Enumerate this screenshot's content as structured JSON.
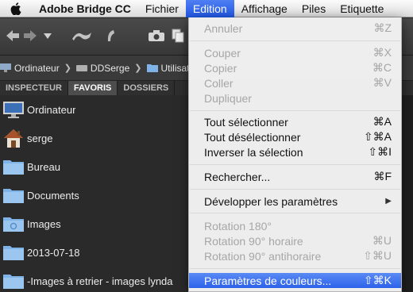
{
  "menubar": {
    "apple_icon": "apple-logo",
    "app_name": "Adobe Bridge CC",
    "items": [
      "Fichier",
      "Edition",
      "Affichage",
      "Piles",
      "Etiquette"
    ],
    "active_index": 1
  },
  "toolbar": {
    "icons": [
      "back-arrow",
      "forward-arrow",
      "dropdown-arrow",
      "boomerang",
      "rotate",
      "camera",
      "copy"
    ]
  },
  "path": {
    "crumbs": [
      "Ordinateur",
      "DDSerge",
      "Utilisat"
    ]
  },
  "tabs": [
    "INSPECTEUR",
    "FAVORIS",
    "DOSSIERS"
  ],
  "tabs_active": 1,
  "favorites": [
    {
      "label": "Ordinateur",
      "icon": "computer-icon"
    },
    {
      "label": "serge",
      "icon": "home-icon"
    },
    {
      "label": "Bureau",
      "icon": "folder-icon"
    },
    {
      "label": "Documents",
      "icon": "folder-icon"
    },
    {
      "label": "Images",
      "icon": "folder-icon"
    },
    {
      "label": "2013-07-18",
      "icon": "folder-icon"
    },
    {
      "label": "-Images à retrier - images lynda",
      "icon": "folder-icon"
    }
  ],
  "edition_menu": {
    "items": [
      {
        "label": "Annuler",
        "shortcut": "⌘Z",
        "enabled": false
      },
      {
        "label": "Couper",
        "shortcut": "⌘X",
        "enabled": false
      },
      {
        "label": "Copier",
        "shortcut": "⌘C",
        "enabled": false
      },
      {
        "label": "Coller",
        "shortcut": "⌘V",
        "enabled": false
      },
      {
        "label": "Dupliquer",
        "shortcut": "",
        "enabled": false
      },
      {
        "label": "Tout sélectionner",
        "shortcut": "⌘A",
        "enabled": true
      },
      {
        "label": "Tout désélectionner",
        "shortcut": "⇧⌘A",
        "enabled": true
      },
      {
        "label": "Inverser la sélection",
        "shortcut": "⇧⌘I",
        "enabled": true
      },
      {
        "label": "Rechercher...",
        "shortcut": "⌘F",
        "enabled": true
      },
      {
        "label": "Développer les paramètres",
        "shortcut": "▶",
        "enabled": true
      },
      {
        "label": "Rotation 180°",
        "shortcut": "",
        "enabled": false
      },
      {
        "label": "Rotation 90° horaire",
        "shortcut": "⌘U",
        "enabled": false
      },
      {
        "label": "Rotation 90° antihoraire",
        "shortcut": "⇧⌘U",
        "enabled": false
      },
      {
        "label": "Paramètres de couleurs...",
        "shortcut": "⇧⌘K",
        "enabled": true,
        "highlighted": true
      }
    ]
  },
  "colors": {
    "menu_highlight": "#2d62ea",
    "disabled_text": "#a6a6a6",
    "panel_bg": "#2a2a2a",
    "folder_blue": "#7fb3e8"
  }
}
